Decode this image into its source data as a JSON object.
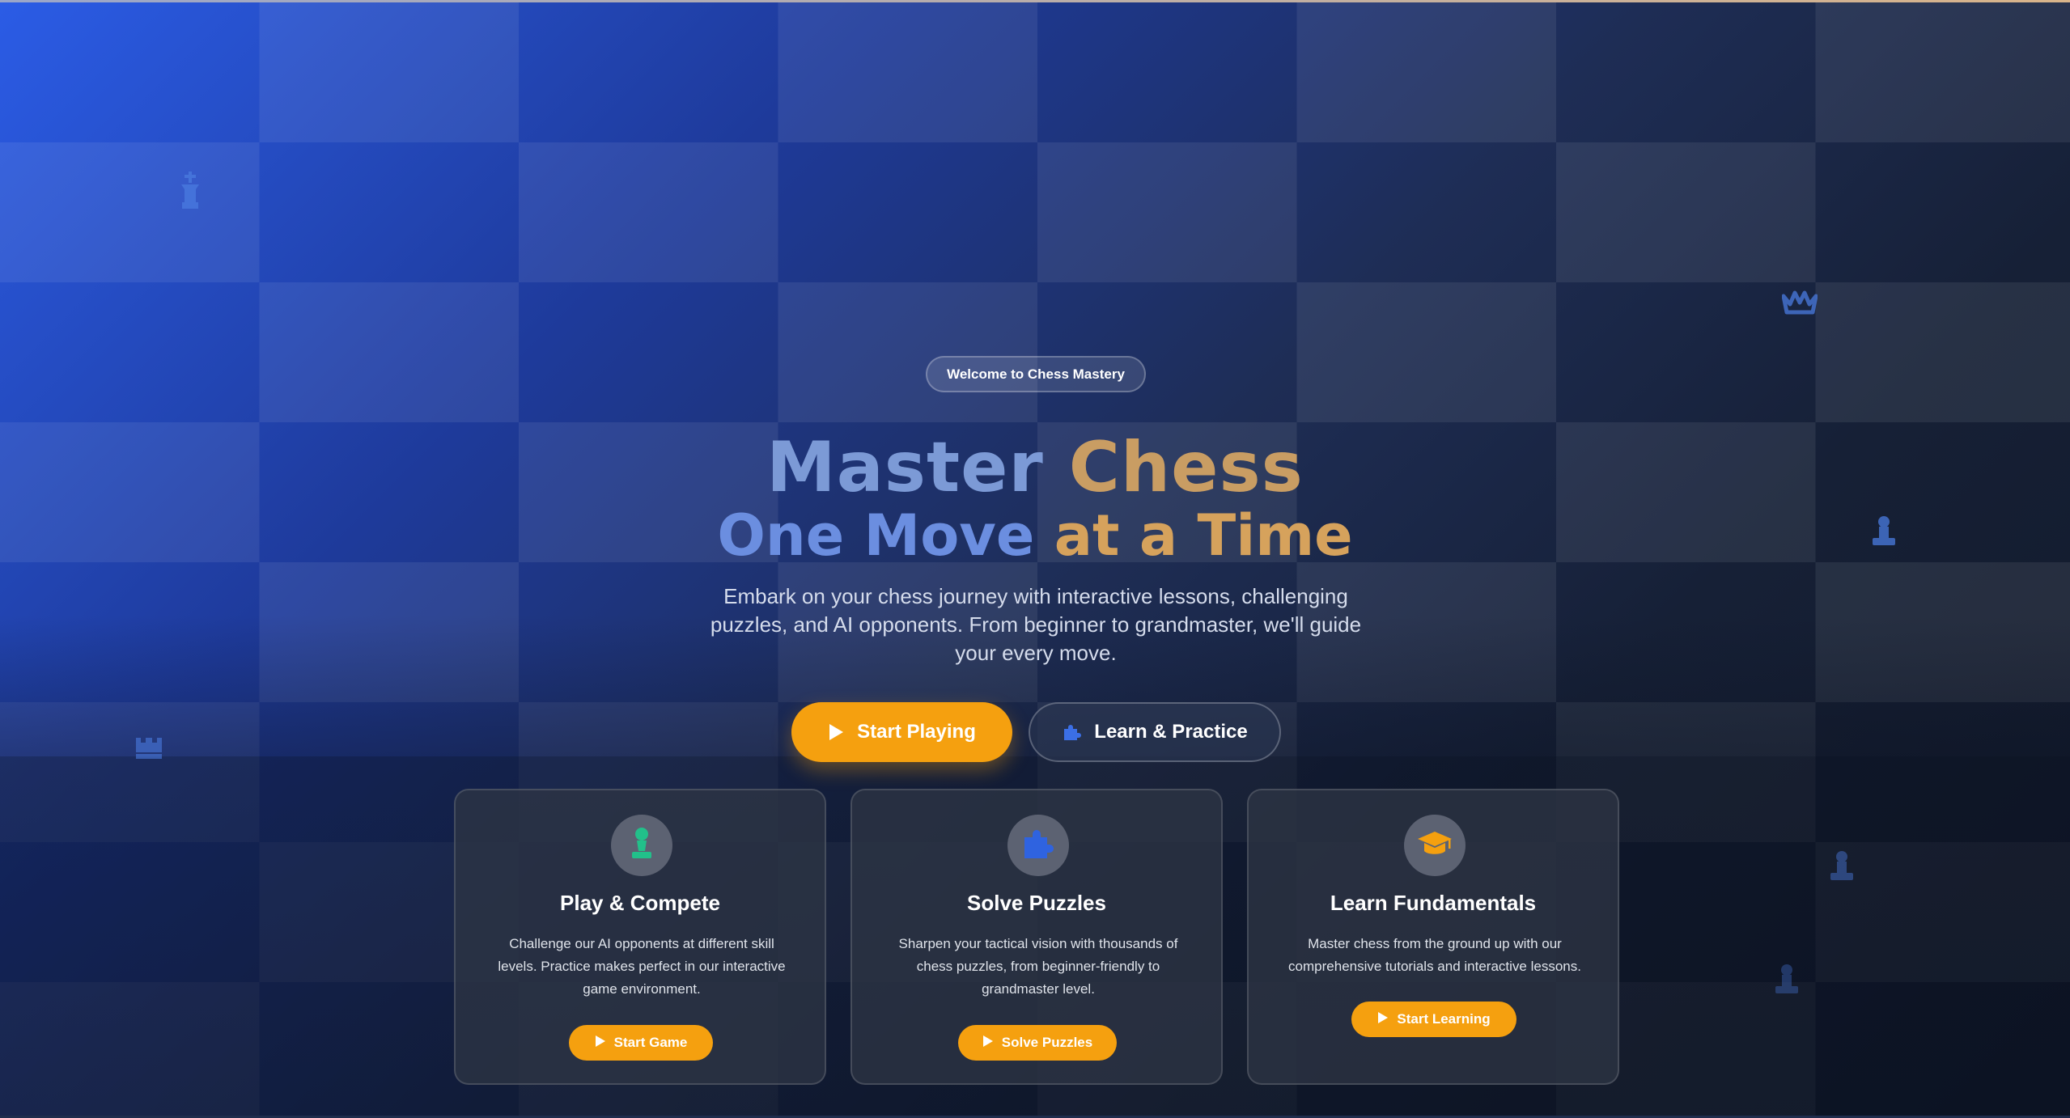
{
  "badge": "Welcome to Chess Mastery",
  "hero": {
    "title_word_1": "Master",
    "title_word_2": "Chess",
    "subtitle_part_1": "One Move",
    "subtitle_part_2": "at a Time",
    "description": "Embark on your chess journey with interactive lessons, challenging puzzles, and AI opponents. From beginner to grandmaster, we'll guide your every move."
  },
  "buttons": {
    "start_playing": "Start Playing",
    "learn_practice": "Learn & Practice"
  },
  "cards": [
    {
      "icon": "chess-pawn-icon",
      "title": "Play & Compete",
      "description": "Challenge our AI opponents at different skill levels. Practice makes perfect in our interactive game environment.",
      "button": "Start Game"
    },
    {
      "icon": "puzzle-piece-icon",
      "title": "Solve Puzzles",
      "description": "Sharpen your tactical vision with thousands of chess puzzles, from beginner-friendly to grandmaster level.",
      "button": "Solve Puzzles"
    },
    {
      "icon": "graduation-cap-icon",
      "title": "Learn Fundamentals",
      "description": "Master chess from the ground up with our comprehensive tutorials and interactive lessons.",
      "button": "Start Learning"
    }
  ],
  "colors": {
    "accent_orange": "#f5a00f",
    "title_blue": "#7c9ad6",
    "title_gold": "#c99d63",
    "pawn_green": "#22c08a",
    "puzzle_blue": "#2f63e0",
    "cap_orange": "#f5a00f"
  },
  "decorative_pieces": [
    "chess-king-icon",
    "chess-queen-crown-icon",
    "chess-pawn-icon",
    "chess-rook-icon",
    "chess-pawn-icon",
    "chess-pawn-icon"
  ]
}
